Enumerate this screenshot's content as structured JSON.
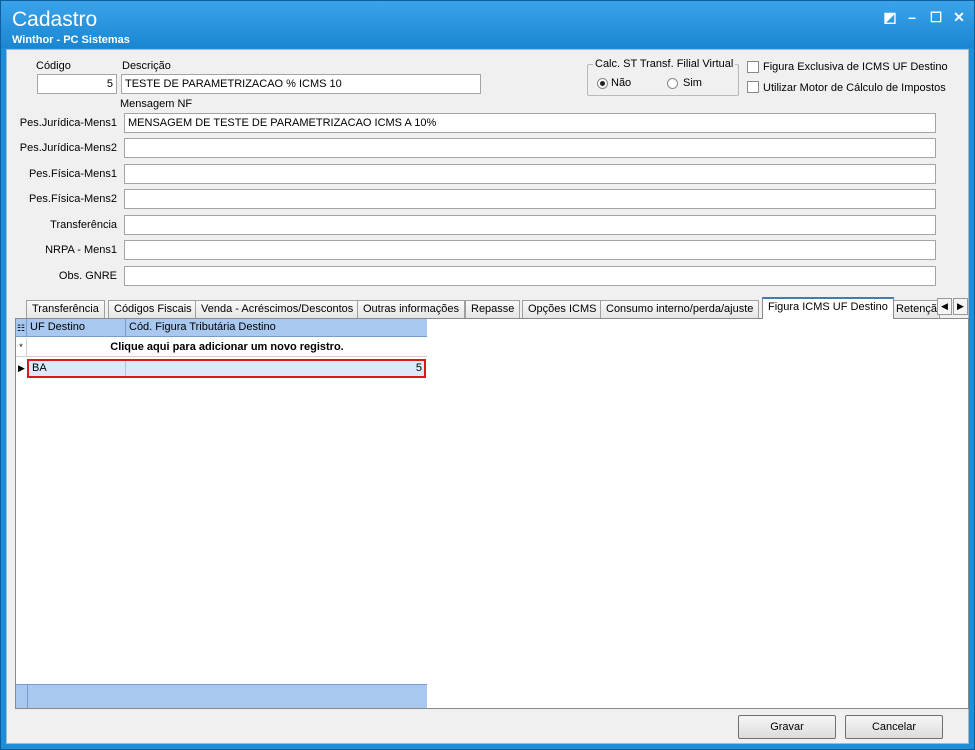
{
  "window": {
    "title": "Cadastro",
    "subtitle": "Winthor - PC Sistemas",
    "controls": {
      "restore": "◩",
      "minimize": "–",
      "maximize": "☐",
      "close": "✕"
    }
  },
  "form": {
    "codigo": {
      "label": "Código",
      "value": "5"
    },
    "descricao": {
      "label": "Descrição",
      "value": "TESTE DE PARAMETRIZACAO % ICMS 10"
    },
    "calc_st": {
      "legend": "Calc. ST Transf. Filial Virtual",
      "options": [
        "Não",
        "Sim"
      ],
      "selected": "Não"
    },
    "checkboxes": [
      {
        "label": "Figura Exclusiva de ICMS UF Destino",
        "checked": false
      },
      {
        "label": "Utilizar Motor de Cálculo de Impostos",
        "checked": false
      }
    ],
    "mensagem_nf_label": "Mensagem NF",
    "messages": [
      {
        "label": "Pes.Jurídica-Mens1",
        "value": "MENSAGEM DE TESTE DE PARAMETRIZACAO ICMS A 10%"
      },
      {
        "label": "Pes.Jurídica-Mens2",
        "value": ""
      },
      {
        "label": "Pes.Física-Mens1",
        "value": ""
      },
      {
        "label": "Pes.Física-Mens2",
        "value": ""
      },
      {
        "label": "Transferência",
        "value": ""
      },
      {
        "label": "NRPA - Mens1",
        "value": ""
      },
      {
        "label": "Obs. GNRE",
        "value": ""
      }
    ]
  },
  "tabs": {
    "items": [
      "Transferência",
      "Códigos Fiscais",
      "Venda - Acréscimos/Descontos",
      "Outras informações",
      "Repasse",
      "Opções ICMS",
      "Consumo interno/perda/ajuste",
      "Figura ICMS UF Destino",
      "Retençã"
    ],
    "active": "Figura ICMS UF Destino",
    "arrow_left": "◀",
    "arrow_right": "▶"
  },
  "grid": {
    "columns": [
      "UF Destino",
      "Cód. Figura Tributária Destino"
    ],
    "add_row_text": "Clique aqui para adicionar um novo registro.",
    "rows": [
      {
        "uf": "BA",
        "codigo": "5"
      }
    ],
    "selector_icons": {
      "header": "☷",
      "new": "*",
      "current": "▶"
    }
  },
  "buttons": {
    "gravar": "Gravar",
    "cancelar": "Cancelar"
  },
  "colors": {
    "titlebar": "#1f8ed8",
    "grid_header": "#a8c8f0",
    "selected_border": "#d9191f"
  }
}
